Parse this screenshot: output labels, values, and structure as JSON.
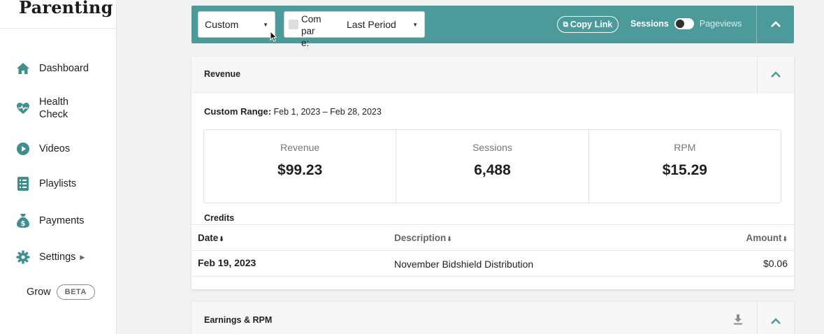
{
  "sidebar": {
    "brand": "Parenting",
    "items": [
      {
        "label": "Dashboard",
        "icon": "home-icon"
      },
      {
        "label": "Health Check",
        "icon": "heart-pulse-icon"
      },
      {
        "label": "Videos",
        "icon": "play-circle-icon"
      },
      {
        "label": "Playlists",
        "icon": "list-icon"
      },
      {
        "label": "Payments",
        "icon": "money-bag-icon"
      },
      {
        "label": "Settings",
        "icon": "gear-icon"
      }
    ],
    "grow_label": "Grow",
    "beta_badge": "BETA"
  },
  "toolbar": {
    "range_select": "Custom",
    "compare_label": "Compare:",
    "compare_value": "Last Period",
    "copy_link": "Copy Link",
    "metric_left": "Sessions",
    "metric_right": "Pageviews"
  },
  "revenue": {
    "title": "Revenue",
    "range_label": "Custom Range:",
    "range_value": "Feb 1, 2023 – Feb 28, 2023",
    "stats": [
      {
        "label": "Revenue",
        "value": "$99.23"
      },
      {
        "label": "Sessions",
        "value": "6,488"
      },
      {
        "label": "RPM",
        "value": "$15.29"
      }
    ],
    "credits_title": "Credits",
    "columns": [
      "Date",
      "Description",
      "Amount"
    ],
    "rows": [
      {
        "date": "Feb 19, 2023",
        "description": "November Bidshield Distribution",
        "amount": "$0.06"
      }
    ]
  },
  "earnings": {
    "title": "Earnings & RPM"
  },
  "colors": {
    "accent": "#4c9b9a",
    "sidebar_icon": "#3f8f8e"
  }
}
